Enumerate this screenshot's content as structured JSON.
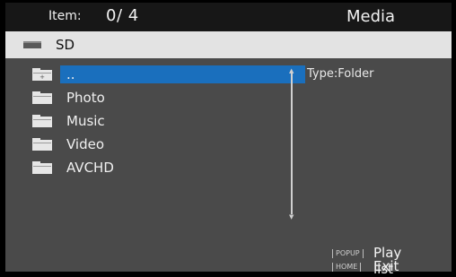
{
  "header": {
    "item_label": "Item:",
    "item_count": "0/ 4",
    "title": "Media"
  },
  "location": {
    "icon": "drive-icon",
    "label": "SD"
  },
  "file_list": {
    "items": [
      {
        "label": "..",
        "icon": "parent-folder-icon",
        "selected": true
      },
      {
        "label": "Photo",
        "icon": "folder-icon",
        "selected": false
      },
      {
        "label": "Music",
        "icon": "folder-icon",
        "selected": false
      },
      {
        "label": "Video",
        "icon": "folder-icon",
        "selected": false
      },
      {
        "label": "AVCHD",
        "icon": "folder-icon",
        "selected": false
      }
    ]
  },
  "info": {
    "type_text": "Type:Folder"
  },
  "footer": {
    "popup_key": "POPUP",
    "popup_action": "Play list",
    "home_key": "HOME",
    "home_action": "Exit"
  },
  "colors": {
    "background": "#4a4a4a",
    "header": "#171717",
    "location_bar": "#e3e3e3",
    "selection": "#1a6fbd",
    "text": "#f0f0f0"
  }
}
